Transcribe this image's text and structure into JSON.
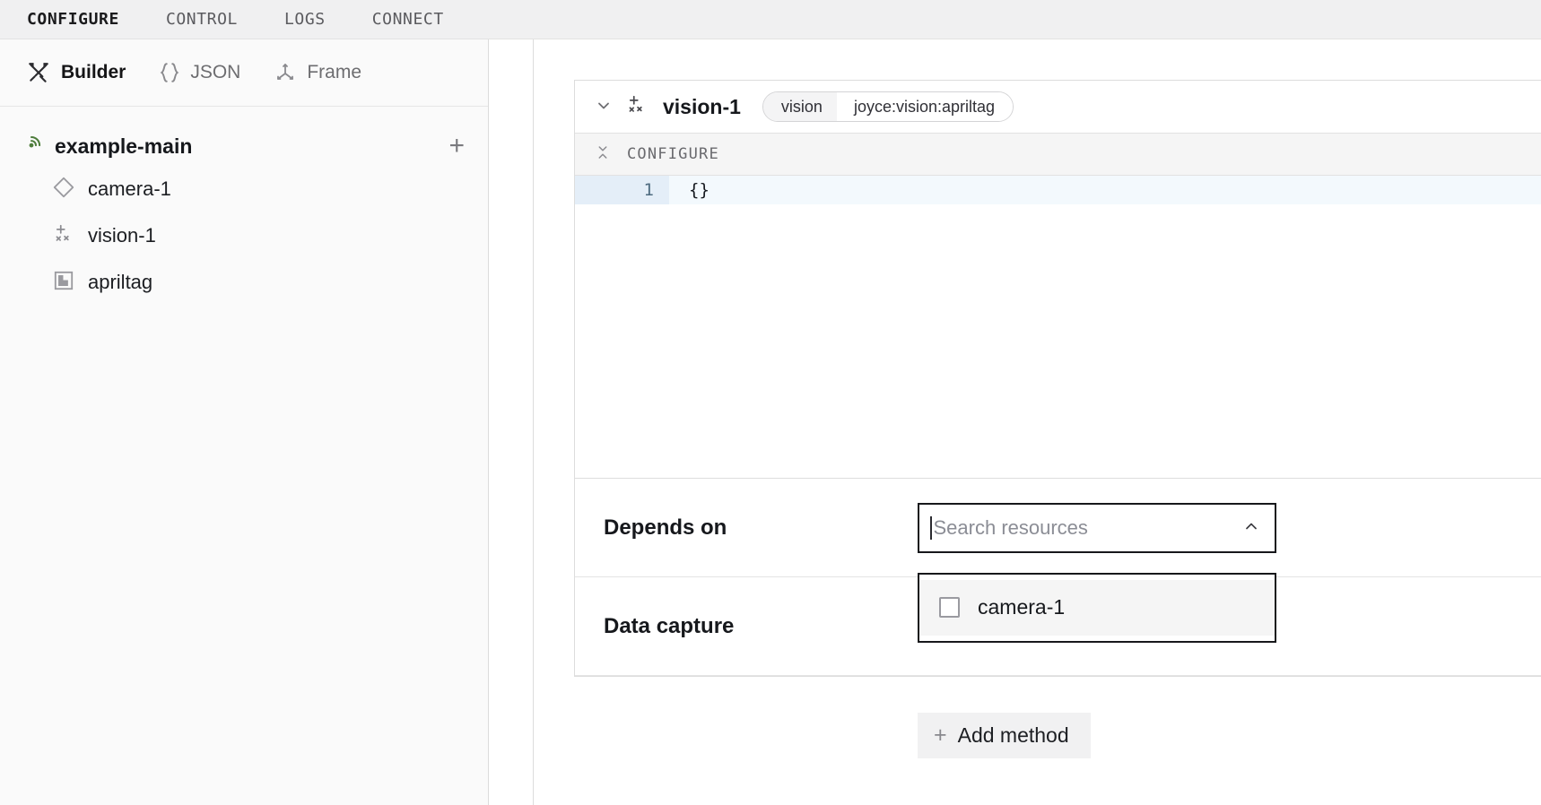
{
  "topnav": {
    "tabs": [
      {
        "label": "CONFIGURE",
        "active": true
      },
      {
        "label": "CONTROL",
        "active": false
      },
      {
        "label": "LOGS",
        "active": false
      },
      {
        "label": "CONNECT",
        "active": false
      }
    ]
  },
  "sidebar": {
    "toolbar": [
      {
        "label": "Builder",
        "icon": "tools-icon",
        "active": true
      },
      {
        "label": "JSON",
        "icon": "braces-icon",
        "active": false
      },
      {
        "label": "Frame",
        "icon": "axes-icon",
        "active": false
      }
    ],
    "tree": {
      "root": {
        "label": "example-main",
        "icon": "machine-radar-icon"
      },
      "add_button": "+",
      "children": [
        {
          "label": "camera-1",
          "icon": "diamond-camera-icon"
        },
        {
          "label": "vision-1",
          "icon": "vision-sparkle-icon"
        },
        {
          "label": "apriltag",
          "icon": "apriltag-square-icon"
        }
      ]
    }
  },
  "main": {
    "card": {
      "title": "vision-1",
      "collapse_icon": "chevron-down-icon",
      "type_icon": "vision-sparkle-icon",
      "pill": {
        "left": "vision",
        "right": "joyce:vision:apriltag"
      },
      "configure_section": {
        "label": "CONFIGURE",
        "collapse_icon": "collapse-vertical-icon",
        "code": {
          "line_number": "1",
          "text": "{}"
        }
      },
      "rows": [
        {
          "label": "Depends on",
          "search": {
            "placeholder": "Search resources",
            "value": "",
            "chevron": "chevron-up-icon"
          },
          "dropdown": {
            "open": true,
            "items": [
              {
                "label": "camera-1",
                "checked": false
              }
            ]
          }
        },
        {
          "label": "Data capture",
          "add_button": {
            "label": "Add method",
            "icon": "plus-icon"
          }
        }
      ]
    }
  }
}
